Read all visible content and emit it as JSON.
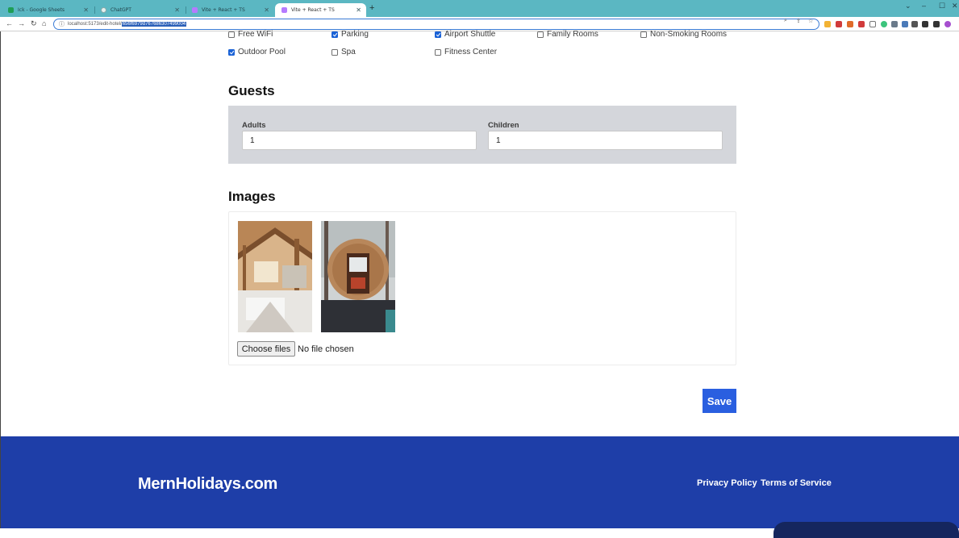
{
  "browser": {
    "tabs": [
      {
        "label": "Ick - Google Sheets",
        "active": false
      },
      {
        "label": "ChatGPT",
        "active": false
      },
      {
        "label": "Vite + React + TS",
        "active": false
      },
      {
        "label": "Vite + React + TS",
        "active": true
      }
    ],
    "new_tab": "+",
    "url_prefix": "localhost:5173/edit-hotel/",
    "url_selected": "656f6979d767686307499004",
    "window_controls": {
      "collapse": "⌄",
      "minimize": "–",
      "maximize": "☐",
      "close": "✕"
    }
  },
  "facilities": [
    {
      "label": "Free WiFi",
      "checked": false
    },
    {
      "label": "Parking",
      "checked": true
    },
    {
      "label": "Airport Shuttle",
      "checked": true
    },
    {
      "label": "Family Rooms",
      "checked": false
    },
    {
      "label": "Non-Smoking Rooms",
      "checked": false
    },
    {
      "label": "Outdoor Pool",
      "checked": true
    },
    {
      "label": "Spa",
      "checked": false
    },
    {
      "label": "Fitness Center",
      "checked": false
    }
  ],
  "guests": {
    "heading": "Guests",
    "adults_label": "Adults",
    "adults_value": "1",
    "children_label": "Children",
    "children_value": "1"
  },
  "images": {
    "heading": "Images",
    "choose_files": "Choose files",
    "no_file": "No file chosen"
  },
  "save_label": "Save",
  "footer": {
    "brand": "MernHolidays.com",
    "privacy": "Privacy Policy",
    "terms": "Terms of Service"
  },
  "colors": {
    "accent": "#2a5fe0",
    "footer": "#1e3ea8",
    "tabbar": "#5bb7c2"
  }
}
